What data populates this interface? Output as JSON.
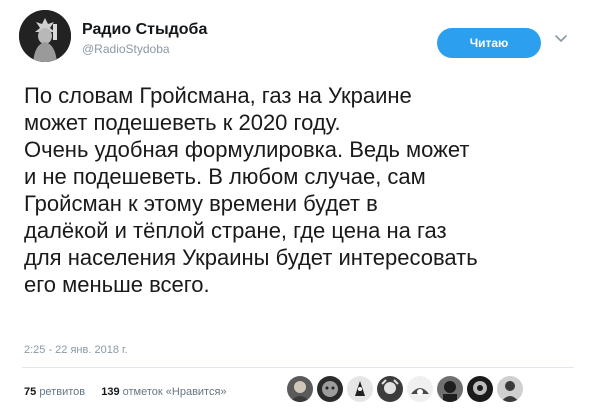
{
  "header": {
    "display_name": "Радио Стыдоба",
    "handle": "@RadioStydoba",
    "follow_label": "Читаю"
  },
  "tweet": {
    "lines": [
      "По словам Гройсмана, газ на Украине",
      "может подешеветь к 2020 году.",
      "Очень удобная формулировка. Ведь может",
      "и не подешеветь. В любом случае, сам",
      "Гройсман к этому времени будет в",
      "далёкой и тёплой стране, где цена на газ",
      "для населения Украины будет интересовать",
      "его меньше всего."
    ],
    "timestamp": "2:25 - 22 янв. 2018 г."
  },
  "stats": {
    "retweets_count": "75",
    "retweets_label": "ретвитов",
    "likes_count": "139",
    "likes_label": "отметок «Нравится»"
  },
  "colors": {
    "accent": "#2d9fef",
    "muted": "#8899a6",
    "divider": "#e1e8ed"
  },
  "icons": {
    "header_menu": "chevron-down-icon"
  }
}
